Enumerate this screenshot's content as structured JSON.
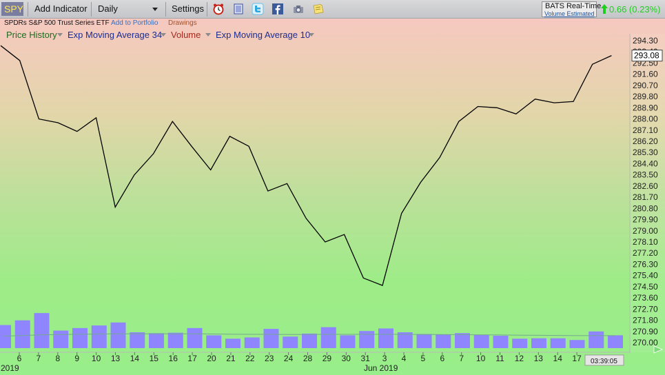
{
  "toolbar": {
    "symbol": "SPY",
    "add_indicator": "Add Indicator",
    "interval": "Daily",
    "settings": "Settings",
    "icons": [
      "alarm-clock-icon",
      "notebook-icon",
      "twitter-icon",
      "facebook-icon",
      "camera-icon",
      "note-icon"
    ],
    "feed_title": "BATS Real-Time",
    "feed_sub": "Volume Estimated",
    "change": "0.66 (0.23%)",
    "change_color": "#1fcf1f"
  },
  "info": {
    "description": "SPDRs S&P 500 Trust Series ETF",
    "add_to_portfolio": "Add to Portfolio",
    "drawings": "Drawings"
  },
  "indicators": [
    {
      "label": "Price History",
      "color": "#1f6b1f"
    },
    {
      "label": "Exp Moving Average 34",
      "color": "#1d2c8f"
    },
    {
      "label": "Volume",
      "color": "#a8271c"
    },
    {
      "label": "Exp Moving Average 10",
      "color": "#1d2c8f"
    }
  ],
  "chart_data": {
    "type": "line",
    "y_tick_labels": [
      "294.30",
      "293.40",
      "292.50",
      "291.60",
      "290.70",
      "289.80",
      "288.90",
      "288.00",
      "287.10",
      "286.20",
      "285.30",
      "284.40",
      "283.50",
      "282.60",
      "281.70",
      "280.80",
      "279.90",
      "279.00",
      "278.10",
      "277.20",
      "276.30",
      "275.40",
      "274.50",
      "273.60",
      "272.70",
      "271.80",
      "270.90",
      "270.00"
    ],
    "ylim": [
      270.0,
      294.3
    ],
    "x_tick_labels": [
      "6",
      "7",
      "8",
      "9",
      "10",
      "13",
      "14",
      "15",
      "16",
      "17",
      "20",
      "21",
      "22",
      "23",
      "24",
      "28",
      "29",
      "30",
      "31",
      "3",
      "4",
      "5",
      "6",
      "7",
      "10",
      "11",
      "12",
      "13",
      "14",
      "17"
    ],
    "x_period_labels": [
      "2019",
      "Jun 2019"
    ],
    "time_label": "03:39:05",
    "last_price": "293.08",
    "price_series": [
      293.9,
      292.7,
      288.0,
      287.7,
      287.0,
      288.1,
      280.9,
      283.5,
      285.2,
      287.8,
      285.8,
      283.9,
      286.6,
      285.8,
      282.2,
      282.8,
      280.0,
      278.1,
      278.7,
      275.2,
      274.6,
      280.4,
      282.9,
      284.9,
      287.8,
      289.0,
      288.9,
      288.4,
      289.6,
      289.3,
      289.4,
      292.4,
      293.1
    ],
    "volume_series": [
      54,
      65,
      82,
      41,
      47,
      53,
      60,
      37,
      35,
      36,
      47,
      30,
      22,
      25,
      45,
      27,
      34,
      49,
      30,
      40,
      46,
      37,
      33,
      32,
      35,
      31,
      29,
      22,
      23,
      23,
      19,
      39,
      30
    ],
    "volume_ema": [
      28,
      29.5,
      31,
      32,
      32.5,
      33,
      33.5,
      33.5,
      33.5,
      33.5,
      33.5,
      33,
      32.5,
      32.3,
      32.3,
      32,
      32,
      32.2,
      32.2,
      32.3,
      32.3,
      32.2,
      32,
      31.8,
      31.5,
      31.2,
      30.8,
      30.3,
      30,
      29.7,
      29.2,
      29.2,
      29.2
    ],
    "colors": {
      "price": "#000000",
      "volume_bar": "#8e85ff",
      "volume_ema": "#74a890"
    }
  }
}
